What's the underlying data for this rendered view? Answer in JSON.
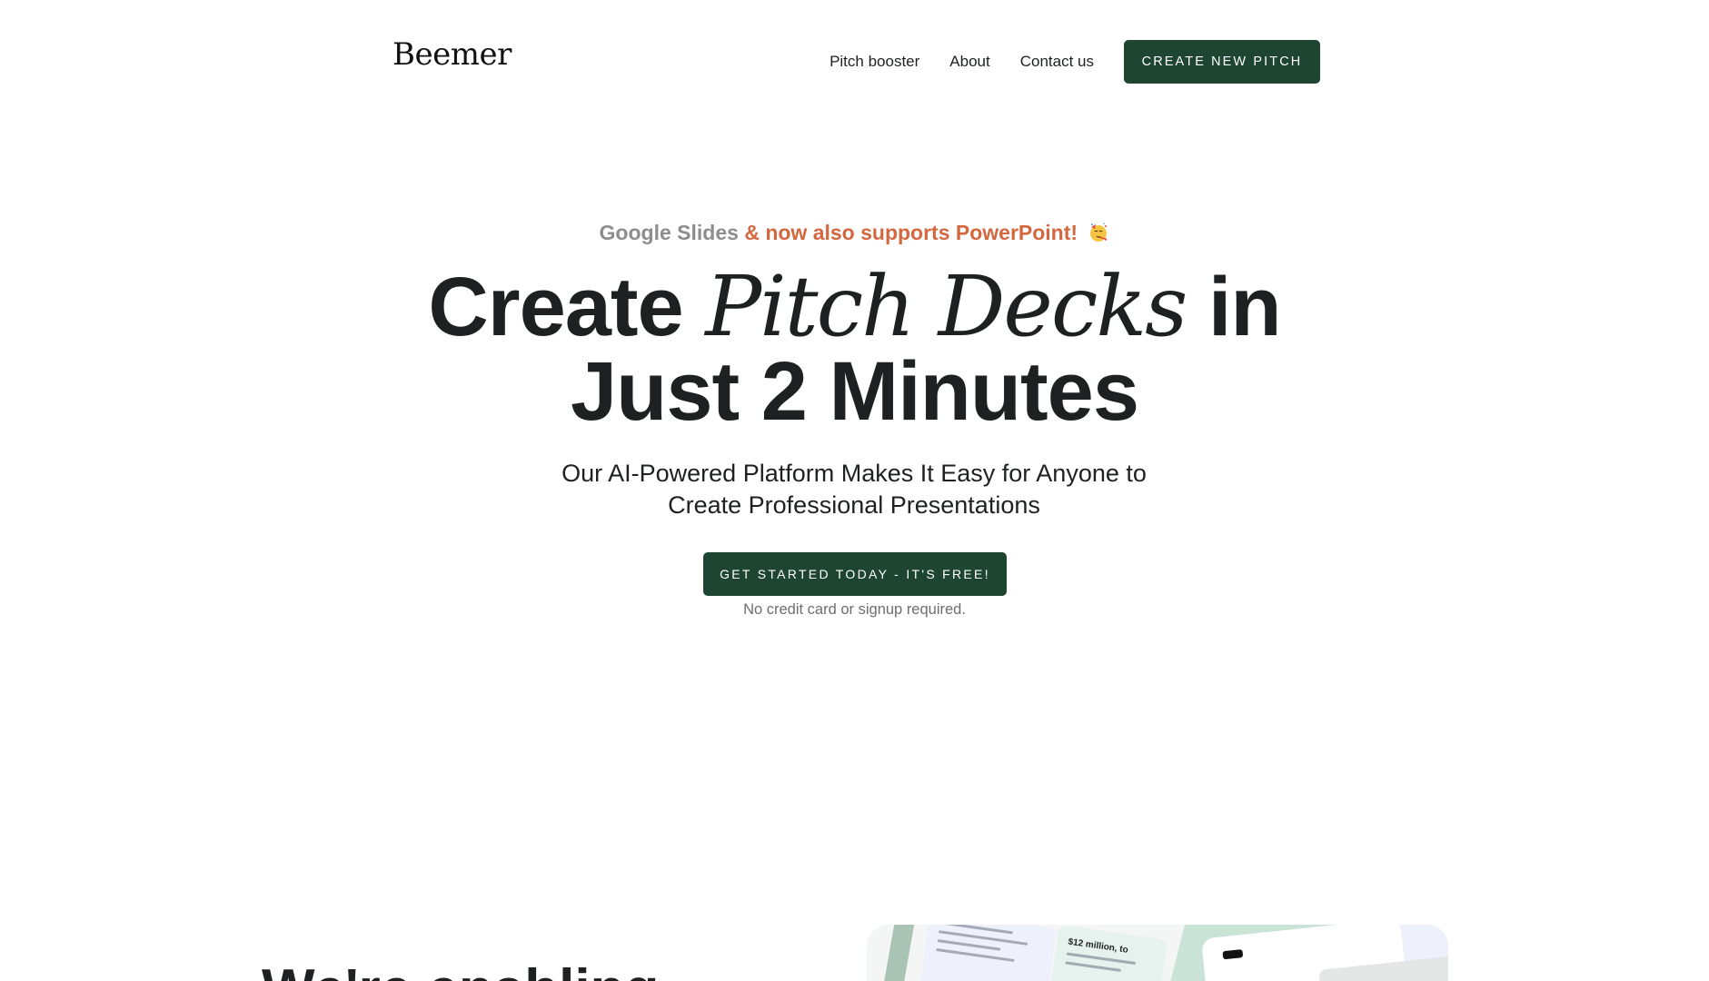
{
  "header": {
    "logo": "Beemer",
    "nav": [
      {
        "label": "Pitch booster"
      },
      {
        "label": "About"
      },
      {
        "label": "Contact us"
      }
    ],
    "cta_label": "CREATE NEW PITCH"
  },
  "hero": {
    "supports_grey": "Google Slides",
    "supports_accent": "& now also supports PowerPoint!",
    "headline_part1": "Create",
    "headline_italic": "Pitch Decks",
    "headline_part2": "in",
    "headline_line2": "Just 2 Minutes",
    "subheadline": "Our AI-Powered Platform Makes It Easy for Anyone to Create Professional Presentations",
    "cta_label": "GET STARTED TODAY - IT'S FREE!",
    "note": "No credit card or signup required."
  },
  "next_section": {
    "title": "We're enabling",
    "preview_text": "$12 million, to"
  },
  "colors": {
    "brand_green": "#1d4532",
    "accent_orange": "#d4673f",
    "muted_grey": "#8d8d8d"
  },
  "icons": {
    "supports": "party-face-icon"
  }
}
